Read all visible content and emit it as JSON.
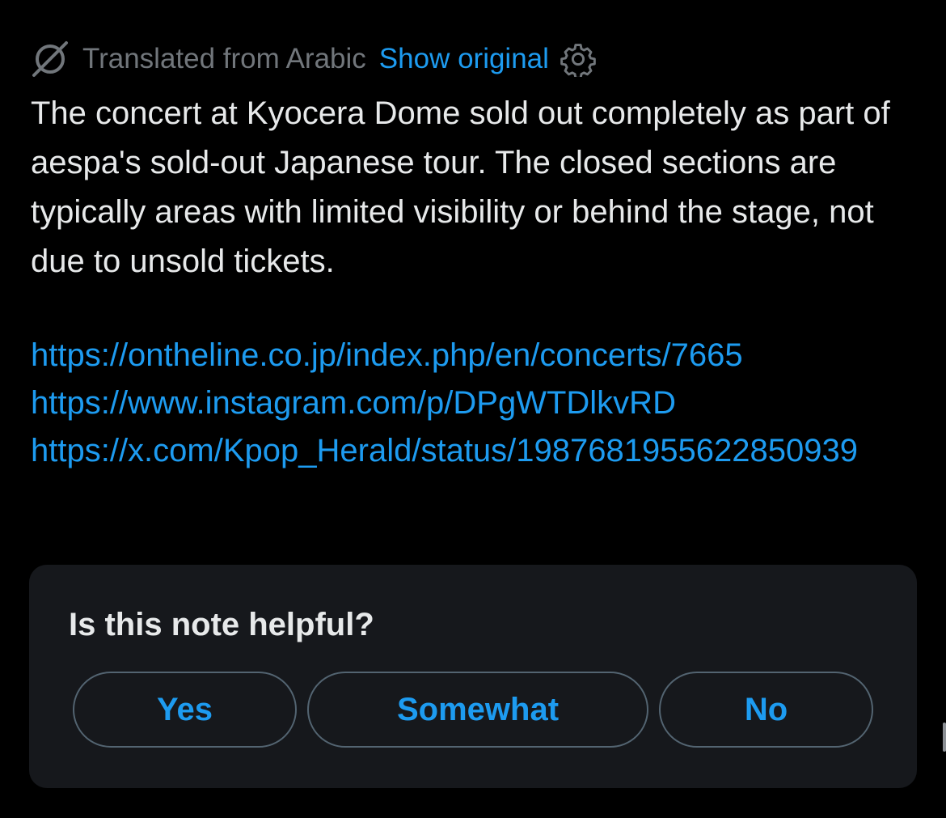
{
  "translation": {
    "label": "Translated from Arabic",
    "show_original": "Show original",
    "translate_icon": "translate-slash-icon",
    "settings_icon": "gear-icon"
  },
  "note": {
    "text": "The concert at Kyocera Dome sold out completely as part of aespa's sold-out Japanese tour. The closed sections are typically areas with limited visibility or behind the stage, not due to unsold tickets.",
    "links": [
      "https://ontheline.co.jp/index.php/en/concerts/7665",
      "https://www.instagram.com/p/DPgWTDlkvRD",
      "https://x.com/Kpop_Herald/status/1987681955622850939"
    ]
  },
  "feedback": {
    "question": "Is this note helpful?",
    "yes_label": "Yes",
    "somewhat_label": "Somewhat",
    "no_label": "No"
  },
  "colors": {
    "background": "#000000",
    "text": "#e7e9ea",
    "muted": "#71767b",
    "accent": "#1d9bf0",
    "card": "#16181c",
    "button_border": "#536471"
  }
}
